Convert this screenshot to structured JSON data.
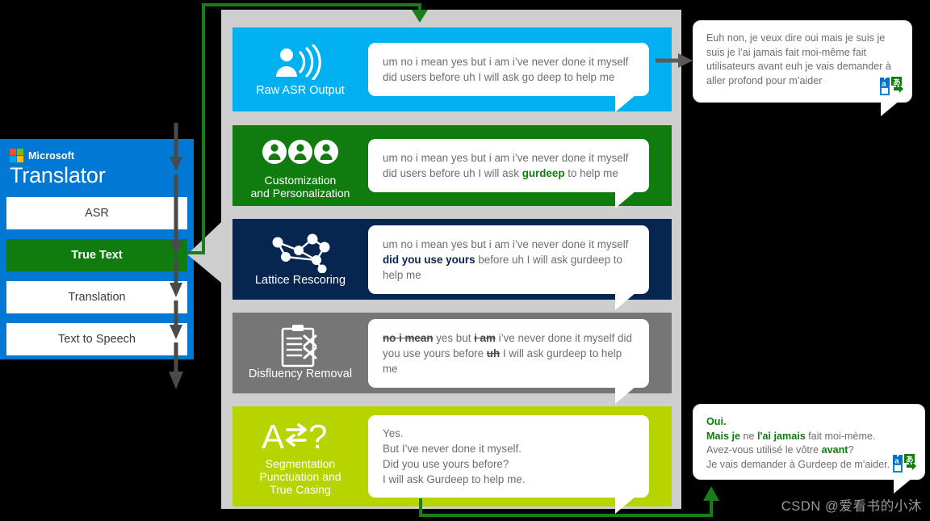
{
  "sidebar": {
    "brand_prefix": "Microsoft",
    "brand_title": "Translator",
    "items": [
      {
        "label": "ASR",
        "active": false
      },
      {
        "label": "True Text",
        "active": true
      },
      {
        "label": "Translation",
        "active": false
      },
      {
        "label": "Text to Speech",
        "active": false
      }
    ],
    "colors": {
      "background": "#0078D4",
      "active_fill": "#107C10",
      "item_fill": "#FFFFFF"
    }
  },
  "pipeline": {
    "background": "#CECECE",
    "stages": [
      {
        "label": "Raw ASR Output",
        "icon": "speaker-person-icon",
        "color": "#00B0F0",
        "text_plain": "um no i mean yes but i am i've never done it myself did users before uh I will ask go deep to help me",
        "text_html": "um no i mean yes but i am i&rsquo;ve never done it myself did users before uh I will ask go deep to help me"
      },
      {
        "label": "Customization\nand Personalization",
        "label_lines": [
          "Customization",
          "and Personalization"
        ],
        "icon": "three-people-icon",
        "color": "#107C10",
        "text_plain": "um no i mean yes but i am i've never done it myself did users before uh I will ask gurdeep to help me",
        "text_html": "um no i mean yes but i am i&rsquo;ve never done it myself did users before uh I will ask <b>gurdeep</b> to help me",
        "highlight": "gurdeep"
      },
      {
        "label": "Lattice Rescoring",
        "icon": "network-lattice-icon",
        "color": "#06254F",
        "text_plain": "um no i mean yes but i am i've never done it myself did you use yours before uh I will ask gurdeep to help me",
        "text_html": "um no i mean yes but i am i&rsquo;ve never done it myself <b>did you use yours</b> before uh I will ask gurdeep to help me",
        "highlight": "did you use yours"
      },
      {
        "label": "Disfluency Removal",
        "icon": "clipboard-strikeout-icon",
        "color": "#767676",
        "text_plain": "no i mean yes but i am i've never done it myself did you use yours before uh I will ask gurdeep to help me",
        "text_html": "<s>no i mean</s> yes but <s>i am</s> i&rsquo;ve never done it myself did you use yours before <s>uh</s> I will ask gurdeep to help me",
        "struck": [
          "no i mean",
          "i am",
          "uh"
        ]
      },
      {
        "label": "Segmentation\nPunctuation and\nTrue Casing",
        "label_lines": [
          "Segmentation",
          "Punctuation and",
          "True Casing"
        ],
        "icon": "a-swap-question-icon",
        "icon_glyph": "A⇄?",
        "color": "#B8D400",
        "text_plain": "Yes.\nBut I've never done it myself.\nDid you use yours before?\nI will ask Gurdeep to help me.",
        "text_html": "Yes.<br>But I&rsquo;ve never done it myself.<br>Did you use yours before?<br>I will ask Gurdeep to help me."
      }
    ]
  },
  "translations": [
    {
      "id": "raw-translation",
      "text_plain": "Euh non, je veux dire oui mais je suis je suis je l'ai jamais fait moi-même fait utilisateurs avant euh je vais demander à aller profond pour m'aider",
      "text_html": "Euh non, je veux dire oui mais je suis je suis je l&rsquo;ai jamais fait moi-m&ecirc;me fait utilisateurs avant euh je vais demander &agrave; aller profond pour m&rsquo;aider",
      "icon": "microsoft-translator-icon"
    },
    {
      "id": "truetext-translation",
      "text_plain": "Oui.\nMais je ne l'ai jamais fait moi-mème.\nAvez-vous utilisé le vôtre avant?\nJe vais demander à Gurdeep de m'aider.",
      "text_html": "<b>Oui.</b><br><b>Mais je</b> ne <b>l'ai jamais</b> fait moi-m&egrave;me.<br>Avez-vous utilis&eacute; le v&ocirc;tre <b>avant</b>?<br>Je vais demander &agrave; Gurdeep de m'aider.",
      "icon": "microsoft-translator-icon"
    }
  ],
  "connectors": {
    "green": "#1B7C1B",
    "gray": "#5A5A5A",
    "callout_gray": "#CECECE"
  },
  "watermark": "CSDN @爱看书的小沐"
}
